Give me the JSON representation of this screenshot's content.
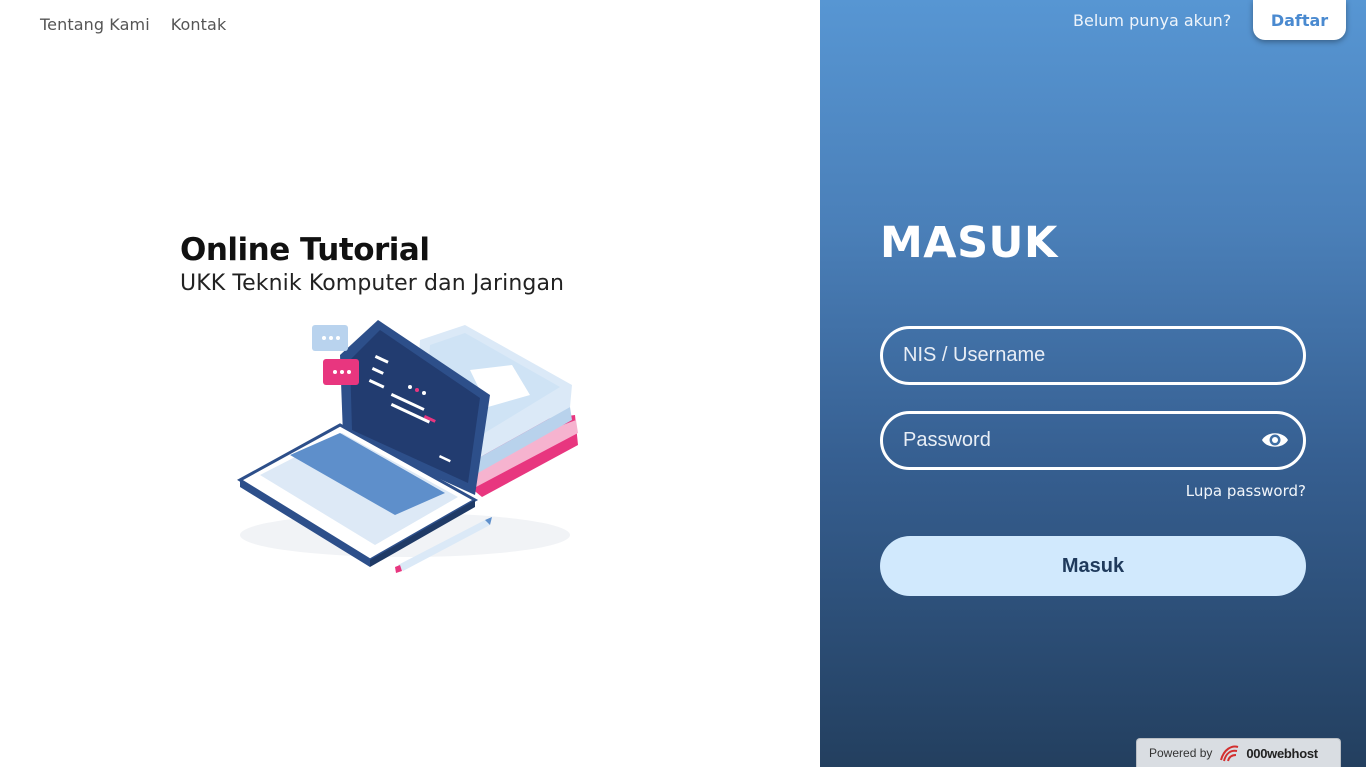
{
  "nav": {
    "items": [
      {
        "label": "Tentang Kami"
      },
      {
        "label": "Kontak"
      }
    ]
  },
  "hero": {
    "title": "Online Tutorial",
    "subtitle": "UKK Teknik Komputer dan Jaringan",
    "illustration_icon": "laptop-books-illustration"
  },
  "auth": {
    "prompt": "Belum punya akun?",
    "signup_label": "Daftar",
    "title": "MASUK",
    "username_placeholder": "NIS / Username",
    "username_value": "",
    "password_placeholder": "Password",
    "password_value": "",
    "toggle_icon": "eye-icon",
    "forgot_label": "Lupa password?",
    "submit_label": "Masuk"
  },
  "footer": {
    "powered_text": "Powered by",
    "brand": "000webhost"
  },
  "colors": {
    "panel_top": "#5796d3",
    "panel_bottom": "#233f5f",
    "button_bg": "#d1e9fd",
    "button_text": "#1f3a5c",
    "signup_text": "#4a8ad0",
    "accent_pink": "#e8367f"
  }
}
